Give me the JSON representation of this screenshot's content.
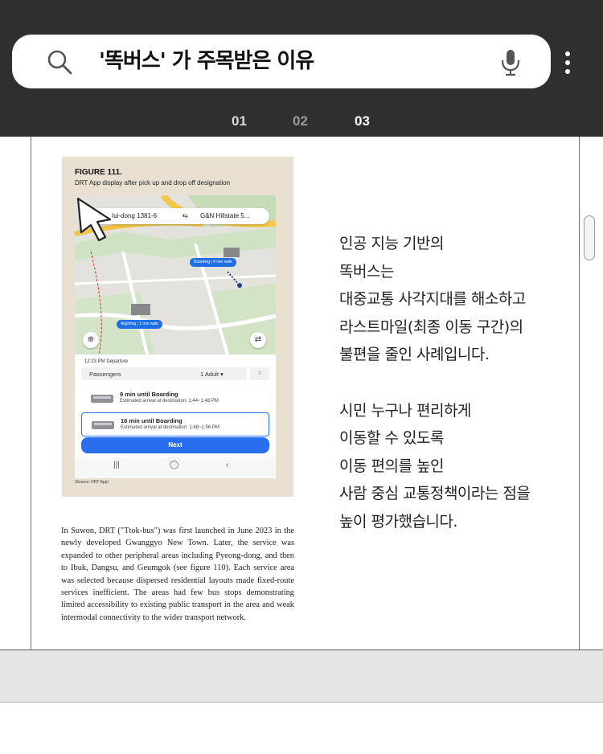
{
  "search": {
    "query": "'똑버스' 가 주목받은 이유"
  },
  "tabs": [
    {
      "label": "01"
    },
    {
      "label": "02"
    },
    {
      "label": "03"
    }
  ],
  "figure": {
    "title": "FIGURE 111.",
    "subtitle": "DRT App display after pick up and drop off designation",
    "route_from": "Iui-dong 1381-6",
    "route_to": "G&N Hillstate 5...",
    "tag_boarding": "Boarding | 4 min walk",
    "tag_alighting": "Alighting | 1 min walk",
    "departure": "12:23 PM Departure",
    "passengers_label": "Passengers",
    "passengers_value": "1 Adult ▾",
    "options": [
      {
        "title": "9 min until Boarding",
        "detail": "Estimated arrival at destination: 1:44~1:48 PM"
      },
      {
        "title": "16 min until Boarding",
        "detail": "Estimated arrival at destination: 1:48~1:56 PM"
      }
    ],
    "next_label": "Next",
    "source": "(Source: DRT App)"
  },
  "paragraph": "In Suwon, DRT (\"Ttok-bus\") was first launched in June 2023 in the newly developed Gwanggyo New Town. Later, the service was expanded to other peripheral areas including Pyeong-dong, and then to Ibuk, Dangsu, and Geumgok (see figure 110). Each service area was selected because dispersed residential layouts made fixed-route services inefficient. The areas had few bus stops demonstrating limited accessibility to existing public transport in the area and weak intermodal connectivity to the wider transport network.",
  "korean": {
    "lines1": [
      "인공 지능 기반의",
      "똑버스는",
      "대중교통 사각지대를 해소하고",
      "라스트마일(최종 이동 구간)의",
      "불편을 줄인 사례입니다."
    ],
    "lines2": [
      "시민 누구나 편리하게",
      "이동할 수 있도록",
      "이동 편의를 높인",
      "사람 중심 교통정책이라는 점을",
      "높이 평가했습니다."
    ]
  },
  "colors": {
    "header_bg": "#2f2f2f",
    "tab_active": "#ffffff",
    "tab_inactive": "#9a9a9a",
    "tab_mid": "#d9d9d9",
    "accent_blue": "#2a6ef0"
  }
}
